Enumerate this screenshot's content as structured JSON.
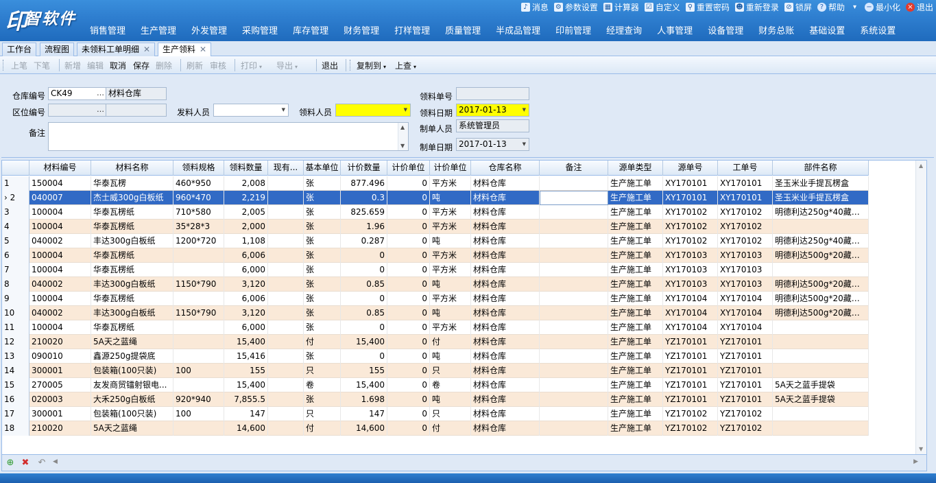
{
  "app": {
    "logo_mark": "印",
    "logo_text": "智软件",
    "brand_color": "#2f7fd0",
    "select_color": "#316ac5",
    "alt_row_color": "#fae9d8"
  },
  "toplinks": [
    {
      "icon": "bell-icon",
      "glyph": "♪",
      "label": "消息"
    },
    {
      "icon": "gear-icon",
      "glyph": "⚙",
      "label": "参数设置"
    },
    {
      "icon": "calculator-icon",
      "glyph": "▦",
      "label": "计算器"
    },
    {
      "icon": "checklist-icon",
      "glyph": "☑",
      "label": "自定义"
    },
    {
      "icon": "search-icon",
      "glyph": "⚲",
      "label": "重置密码"
    },
    {
      "icon": "users-icon",
      "glyph": "☻",
      "label": "重新登录"
    },
    {
      "icon": "lock-icon",
      "glyph": "⊘",
      "label": "锁屏"
    },
    {
      "icon": "help-icon",
      "glyph": "?",
      "label": "帮助"
    },
    {
      "icon": "chevron-down-icon",
      "glyph": "▾",
      "label": ""
    },
    {
      "icon": "minimize-icon",
      "glyph": "−",
      "label": "最小化"
    },
    {
      "icon": "close-icon",
      "glyph": "×",
      "label": "退出"
    }
  ],
  "mainnav": [
    "销售管理",
    "生产管理",
    "外发管理",
    "采购管理",
    "库存管理",
    "财务管理",
    "打样管理",
    "质量管理",
    "半成品管理",
    "印前管理",
    "经理查询",
    "人事管理",
    "设备管理",
    "财务总账",
    "基础设置",
    "系统设置"
  ],
  "tabs": [
    {
      "label": "工作台",
      "closable": false,
      "active": false
    },
    {
      "label": "流程图",
      "closable": false,
      "active": false
    },
    {
      "label": "未领料工单明细",
      "closable": true,
      "active": false
    },
    {
      "label": "生产领料",
      "closable": true,
      "active": true
    }
  ],
  "toolbar": {
    "prev": "上笔",
    "next": "下笔",
    "add": "新增",
    "edit": "编辑",
    "cancel": "取消",
    "save": "保存",
    "delete": "删除",
    "refresh": "刷新",
    "audit": "审核",
    "print": "打印",
    "export": "导出",
    "exit": "退出",
    "copy_to": "复制到",
    "lookup": "上查"
  },
  "form": {
    "warehouse_code_label": "仓库编号",
    "warehouse_code": "CK49",
    "warehouse_name": "材料仓库",
    "location_code_label": "区位编号",
    "location_code": "",
    "location_name": "",
    "issuer_label": "发料人员",
    "issuer": "",
    "receiver_label": "领料人员",
    "receiver": "",
    "remark_label": "备注",
    "remark": "",
    "doc_no_label": "领料单号",
    "doc_no": "",
    "doc_date_label": "领料日期",
    "doc_date": "2017-01-13",
    "maker_label": "制单人员",
    "maker": "系统管理员",
    "make_date_label": "制单日期",
    "make_date": "2017-01-13"
  },
  "grid": {
    "columns": [
      "材料编号",
      "材料名称",
      "领料规格",
      "领料数量",
      "现有...",
      "基本单位",
      "计价数量",
      "计价单位",
      "计价单位",
      "仓库名称",
      "备注",
      "源单类型",
      "源单号",
      "工单号",
      "部件名称"
    ],
    "selected_index": 1,
    "rows": [
      [
        "1",
        "150004",
        "华泰瓦楞",
        "460*950",
        "2,008",
        "",
        "张",
        "877.496",
        "0",
        "平方米",
        "材料仓库",
        "",
        "生产施工单",
        "XY170101",
        "XY170101",
        "圣玉米业手提瓦楞盒"
      ],
      [
        "2",
        "040007",
        "杰士威300g白板纸",
        "960*470",
        "2,219",
        "",
        "张",
        "0.3",
        "0",
        "吨",
        "材料仓库",
        "",
        "生产施工单",
        "XY170101",
        "XY170101",
        "圣玉米业手提瓦楞盒"
      ],
      [
        "3",
        "100004",
        "华泰瓦楞纸",
        "710*580",
        "2,005",
        "",
        "张",
        "825.659",
        "0",
        "平方米",
        "材料仓库",
        "",
        "生产施工单",
        "XY170102",
        "XY170102",
        "明德利达250g*40藏通..."
      ],
      [
        "4",
        "100004",
        "华泰瓦楞纸",
        "35*28*3",
        "2,000",
        "",
        "张",
        "1.96",
        "0",
        "平方米",
        "材料仓库",
        "",
        "生产施工单",
        "XY170102",
        "XY170102",
        ""
      ],
      [
        "5",
        "040002",
        "丰达300g白板纸",
        "1200*720",
        "1,108",
        "",
        "张",
        "0.287",
        "0",
        "吨",
        "材料仓库",
        "",
        "生产施工单",
        "XY170102",
        "XY170102",
        "明德利达250g*40藏通..."
      ],
      [
        "6",
        "100004",
        "华泰瓦楞纸",
        "",
        "6,006",
        "",
        "张",
        "0",
        "0",
        "平方米",
        "材料仓库",
        "",
        "生产施工单",
        "XY170103",
        "XY170103",
        "明德利达500g*20藏铝..."
      ],
      [
        "7",
        "100004",
        "华泰瓦楞纸",
        "",
        "6,000",
        "",
        "张",
        "0",
        "0",
        "平方米",
        "材料仓库",
        "",
        "生产施工单",
        "XY170103",
        "XY170103",
        ""
      ],
      [
        "8",
        "040002",
        "丰达300g白板纸",
        "1150*790",
        "3,120",
        "",
        "张",
        "0.85",
        "0",
        "吨",
        "材料仓库",
        "",
        "生产施工单",
        "XY170103",
        "XY170103",
        "明德利达500g*20藏铝..."
      ],
      [
        "9",
        "100004",
        "华泰瓦楞纸",
        "",
        "6,006",
        "",
        "张",
        "0",
        "0",
        "平方米",
        "材料仓库",
        "",
        "生产施工单",
        "XY170104",
        "XY170104",
        "明德利达500g*20藏铝..."
      ],
      [
        "10",
        "040002",
        "丰达300g白板纸",
        "1150*790",
        "3,120",
        "",
        "张",
        "0.85",
        "0",
        "吨",
        "材料仓库",
        "",
        "生产施工单",
        "XY170104",
        "XY170104",
        "明德利达500g*20藏铝..."
      ],
      [
        "11",
        "100004",
        "华泰瓦楞纸",
        "",
        "6,000",
        "",
        "张",
        "0",
        "0",
        "平方米",
        "材料仓库",
        "",
        "生产施工单",
        "XY170104",
        "XY170104",
        ""
      ],
      [
        "12",
        "210020",
        "5A天之蓝绳",
        "",
        "15,400",
        "",
        "付",
        "15,400",
        "0",
        "付",
        "材料仓库",
        "",
        "生产施工单",
        "YZ170101",
        "YZ170101",
        ""
      ],
      [
        "13",
        "090010",
        "鑫源250g提袋底",
        "",
        "15,416",
        "",
        "张",
        "0",
        "0",
        "吨",
        "材料仓库",
        "",
        "生产施工单",
        "YZ170101",
        "YZ170101",
        ""
      ],
      [
        "14",
        "300001",
        "包装箱(100只装)",
        "100",
        "155",
        "",
        "只",
        "155",
        "0",
        "只",
        "材料仓库",
        "",
        "生产施工单",
        "YZ170101",
        "YZ170101",
        ""
      ],
      [
        "15",
        "270005",
        "友发商贸镭射银电...",
        "",
        "15,400",
        "",
        "卷",
        "15,400",
        "0",
        "卷",
        "材料仓库",
        "",
        "生产施工单",
        "YZ170101",
        "YZ170101",
        "5A天之蓝手提袋"
      ],
      [
        "16",
        "020003",
        "大禾250g白板纸",
        "920*940",
        "7,855.5",
        "",
        "张",
        "1.698",
        "0",
        "吨",
        "材料仓库",
        "",
        "生产施工单",
        "YZ170101",
        "YZ170101",
        "5A天之蓝手提袋"
      ],
      [
        "17",
        "300001",
        "包装箱(100只装)",
        "100",
        "147",
        "",
        "只",
        "147",
        "0",
        "只",
        "材料仓库",
        "",
        "生产施工单",
        "YZ170102",
        "YZ170102",
        ""
      ],
      [
        "18",
        "210020",
        "5A天之蓝绳",
        "",
        "14,600",
        "",
        "付",
        "14,600",
        "0",
        "付",
        "材料仓库",
        "",
        "生产施工单",
        "YZ170102",
        "YZ170102",
        ""
      ]
    ]
  },
  "footer": {
    "add_icon": "add-row-icon",
    "delete_icon": "delete-row-icon",
    "undo_icon": "undo-icon"
  }
}
